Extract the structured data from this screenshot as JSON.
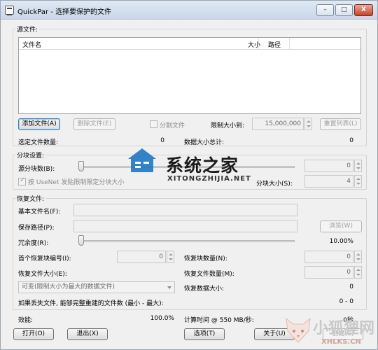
{
  "window": {
    "title": "QuickPar - 选择要保护的文件",
    "min_label": "–",
    "max_label": "□",
    "close_label": "X"
  },
  "source": {
    "group_label": "源文件:",
    "columns": [
      "文件名",
      "大小",
      "路径"
    ],
    "add_button": "添加文件(A)",
    "remove_button": "删除文件(E)",
    "split_label": "分割文件",
    "limit_label": "限制大小到:",
    "limit_value": "15,000,000",
    "reset_button": "重置列表(L)",
    "selected_count_label": "选定文件数量:",
    "selected_count_value": "0",
    "total_size_label": "数据大小总计:",
    "total_size_value": "0"
  },
  "blocks": {
    "group_label": "分块设置:",
    "source_blocks_label": "源分块数(B):",
    "source_blocks_value": "0",
    "usenet_label": "按 UseNet 发贴限制限定分块大小",
    "block_size_label": "分块大小(S):",
    "block_size_value": "4"
  },
  "recovery": {
    "group_label": "恢复文件:",
    "base_name_label": "基本文件名(F):",
    "base_name_value": "",
    "save_path_label": "保存路径(P):",
    "save_path_value": "",
    "browse_button": "浏览(W)",
    "redundancy_label": "冗余度(R):",
    "redundancy_value": "10.00%",
    "first_block_label": "首个恢复块编号(I):",
    "first_block_value": "0",
    "recovery_blocks_label": "恢复块数量(N):",
    "recovery_blocks_value": "0",
    "file_size_label": "恢复文件大小(E):",
    "recovery_files_label": "恢复文件数量(M):",
    "recovery_files_value": "0",
    "size_option": "可变(限制大小为最大的数据文件)",
    "data_size_label": "恢复数据大小:",
    "data_size_value": "0",
    "lost_files_label": "如果丢失文件, 能够完整重建的文件数 (最小 - 最大):",
    "lost_files_value": "0 - 0"
  },
  "status": {
    "efficiency_label": "效能:",
    "efficiency_value": "100.0%",
    "time_label": "计算时间 @ 550 MB/秒:",
    "time_value": "0秒"
  },
  "buttons": {
    "open": "打开(O)",
    "exit": "退出(X)",
    "options": "选项(T)",
    "about": "关于(U)",
    "create": "创建(C)"
  },
  "overlay": {
    "watermark_1": "系统之家",
    "watermark_1_sub": "XITONGZHIJIA.NET",
    "watermark_2": "小狐狸网",
    "watermark_2_sub": "XHLKS.CN"
  }
}
